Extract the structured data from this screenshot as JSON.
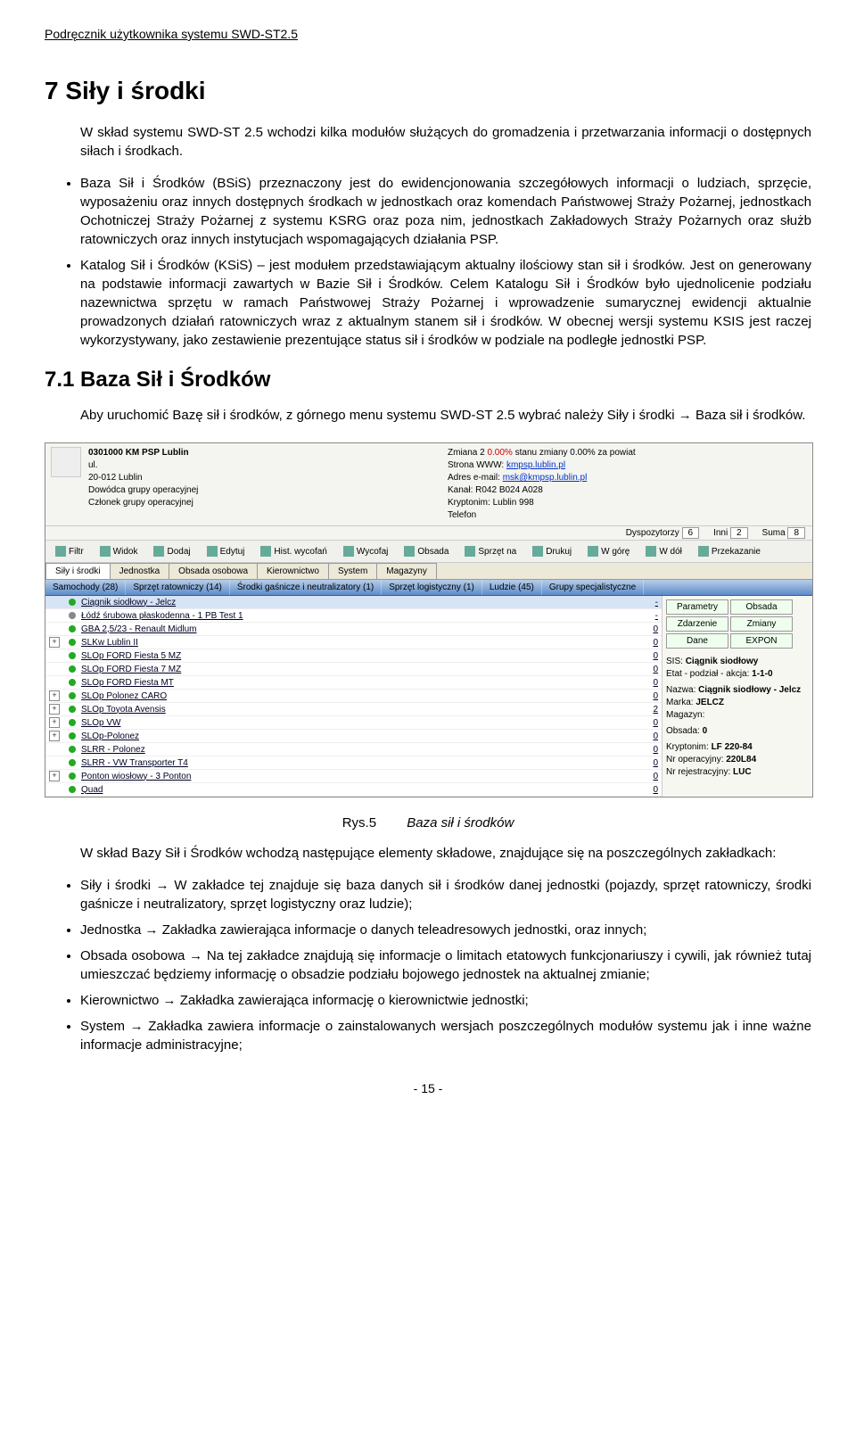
{
  "header": "Podręcznik użytkownika systemu SWD-ST2.5",
  "h1": "7  Siły i środki",
  "intro": "W skład systemu SWD-ST 2.5 wchodzi kilka modułów służących do gromadzenia i przetwarzania  informacji o dostępnych siłach i środkach.",
  "bullets_top": [
    "Baza Sił i Środków  (BSiS) przeznaczony jest do ewidencjonowania szczegółowych informacji o ludziach, sprzęcie, wyposażeniu oraz innych dostępnych środkach w jednostkach oraz komendach Państwowej Straży Pożarnej, jednostkach Ochotniczej Straży Pożarnej z systemu KSRG oraz poza nim, jednostkach Zakładowych Straży Pożarnych oraz służb ratowniczych oraz innych instytucjach wspomagających działania PSP.",
    "Katalog Sił i Środków  (KSiS) – jest modułem przedstawiającym aktualny ilościowy stan sił i środków. Jest on generowany na podstawie informacji zawartych w Bazie Sił i Środków. Celem Katalogu Sił i Środków było ujednolicenie podziału nazewnictwa sprzętu w ramach Państwowej Straży Pożarnej i wprowadzenie sumarycznej ewidencji aktualnie prowadzonych działań ratowniczych wraz z aktualnym stanem sił i środków. W obecnej wersji systemu KSIS jest raczej wykorzystywany, jako zestawienie prezentujące status sił i środków w podziale na podległe jednostki PSP."
  ],
  "h2": "7.1 Baza Sił i Środków",
  "para_launch": "Aby uruchomić Bazę sił i środków, z górnego menu systemu SWD-ST 2.5 wybrać należy Siły i środki → Baza sił i środków.",
  "ss": {
    "title": "0301000 KM PSP Lublin",
    "addr1": "ul.",
    "addr2": "20-012 Lublin",
    "dowodca": "Dowódca grupy operacyjnej",
    "czlonek": "Członek grupy operacyjnej",
    "zmiana": "Zmiana 2",
    "zmiana_pct": "0.00%",
    "zmiana_rest": "stanu zmiany 0.00% za powiat",
    "www_lbl": "Strona WWW:",
    "www": "kmpsp.lublin.pl",
    "email_lbl": "Adres e-mail:",
    "email": "msk@kmpsp.lublin.pl",
    "kanal": "Kanał: R042 B024 A028",
    "krypt": "Kryptonim: Lublin 998",
    "tel": "Telefon",
    "stats": {
      "dys_lbl": "Dyspozytorzy",
      "dys": "6",
      "inni_lbl": "Inni",
      "inni": "2",
      "suma_lbl": "Suma",
      "suma": "8"
    },
    "toolbar": [
      "Filtr",
      "Widok",
      "Dodaj",
      "Edytuj",
      "Hist. wycofań",
      "Wycofaj",
      "Obsada",
      "Sprzęt na",
      "Drukuj",
      "W górę",
      "W dół",
      "Przekazanie"
    ],
    "tabs": [
      "Siły i środki",
      "Jednostka",
      "Obsada osobowa",
      "Kierownictwo",
      "System",
      "Magazyny"
    ],
    "subtabs": [
      "Samochody (28)",
      "Sprzęt ratowniczy (14)",
      "Środki gaśnicze i neutralizatory (1)",
      "Sprzęt logistyczny (1)",
      "Ludzie (45)",
      "Grupy specjalistyczne"
    ],
    "rows": [
      {
        "p": " ",
        "g": true,
        "n": "Ciągnik siodłowy - Jelcz",
        "v": "-",
        "hl": true
      },
      {
        "p": " ",
        "g": false,
        "n": "Łódź śrubowa płaskodenna - 1 PB Test 1",
        "v": "-"
      },
      {
        "p": " ",
        "g": true,
        "n": "GBA 2,5/23 - Renault Midlum",
        "v": "0"
      },
      {
        "p": "+",
        "g": true,
        "n": "SLKw Lublin II",
        "v": "0"
      },
      {
        "p": " ",
        "g": true,
        "n": "SLOp FORD Fiesta 5 MZ",
        "v": "0"
      },
      {
        "p": " ",
        "g": true,
        "n": "SLOp FORD Fiesta 7 MZ",
        "v": "0"
      },
      {
        "p": " ",
        "g": true,
        "n": "SLOp FORD Fiesta MT",
        "v": "0"
      },
      {
        "p": "+",
        "g": true,
        "n": "SLOp Polonez CARO",
        "v": "0"
      },
      {
        "p": "+",
        "g": true,
        "n": "SLOp Toyota Avensis",
        "v": "2"
      },
      {
        "p": "+",
        "g": true,
        "n": "SLOp VW",
        "v": "0"
      },
      {
        "p": "+",
        "g": true,
        "n": "SLOp-Polonez",
        "v": "0"
      },
      {
        "p": " ",
        "g": true,
        "n": "SLRR - Polonez",
        "v": "0"
      },
      {
        "p": " ",
        "g": true,
        "n": "SLRR - VW Transporter T4",
        "v": "0"
      },
      {
        "p": "+",
        "g": true,
        "n": "Ponton wiosłowy - 3 Ponton",
        "v": "0"
      },
      {
        "p": " ",
        "g": true,
        "n": "Quad",
        "v": "0"
      }
    ],
    "panel_btns": [
      [
        "Parametry",
        "Obsada"
      ],
      [
        "Zdarzenie",
        "Zmiany"
      ],
      [
        "Dane",
        "EXPON"
      ]
    ],
    "panel": {
      "sis_lbl": "SIS:",
      "sis": "Ciągnik siodłowy",
      "etat_lbl": "Etat - podział - akcja:",
      "etat": "1-1-0",
      "nazwa_lbl": "Nazwa:",
      "nazwa": "Ciągnik siodłowy - Jelcz",
      "marka_lbl": "Marka:",
      "marka": "JELCZ",
      "mag_lbl": "Magazyn:",
      "obs_lbl": "Obsada:",
      "obs": "0",
      "kr_lbl": "Kryptonim:",
      "kr": "LF 220-84",
      "nrop_lbl": "Nr operacyjny:",
      "nrop": "220L84",
      "nrrej_lbl": "Nr rejestracyjny:",
      "nrrej": "LUC"
    }
  },
  "caption_num": "Rys.5",
  "caption_txt": "Baza sił i środków",
  "para_after": "W skład Bazy Sił i Środków wchodzą następujące elementy składowe, znajdujące się na poszczególnych zakładkach:",
  "bullets_bottom": [
    "Siły i środki → W zakładce tej znajduje się baza danych sił i środków danej jednostki (pojazdy, sprzęt ratowniczy, środki gaśnicze i neutralizatory, sprzęt logistyczny oraz ludzie);",
    "Jednostka → Zakładka zawierająca informacje o danych teleadresowych jednostki, oraz innych;",
    "Obsada osobowa → Na tej zakładce znajdują się informacje o limitach etatowych funkcjonariuszy i cywili, jak również tutaj umieszczać będziemy informację o obsadzie podziału bojowego jednostek na aktualnej zmianie;",
    "Kierownictwo → Zakładka zawierająca informację o kierownictwie jednostki;",
    "System → Zakładka zawiera informacje o zainstalowanych wersjach poszczególnych modułów systemu jak i inne ważne informacje administracyjne;"
  ],
  "footer": "- 15 -"
}
